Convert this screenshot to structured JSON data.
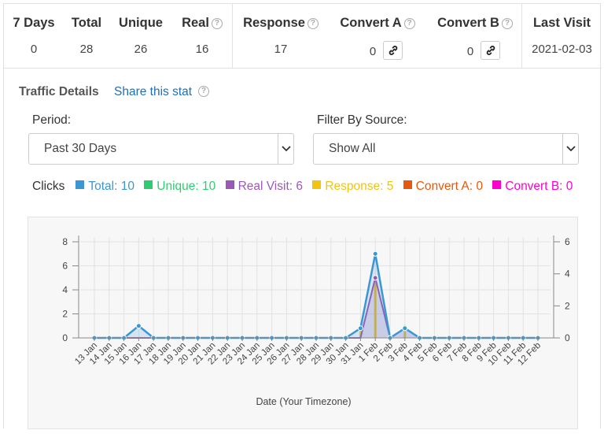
{
  "stats": {
    "columns": [
      {
        "label": "7 Days",
        "value": "0"
      },
      {
        "label": "Total",
        "value": "28"
      },
      {
        "label": "Unique",
        "value": "26"
      },
      {
        "label": "Real",
        "value": "16"
      },
      {
        "label": "Response",
        "value": "17"
      },
      {
        "label": "Convert A",
        "value": "0"
      },
      {
        "label": "Convert B",
        "value": "0"
      },
      {
        "label": "Last Visit",
        "value": "2021-02-03"
      }
    ],
    "help_glyph": "?"
  },
  "traffic": {
    "title": "Traffic Details",
    "share_label": "Share this stat",
    "period_label": "Period:",
    "period_value": "Past 30 Days",
    "source_label": "Filter By Source:",
    "source_value": "Show All"
  },
  "legend": {
    "title": "Clicks",
    "items": [
      {
        "label": "Total: 10",
        "color": "#3b97d3"
      },
      {
        "label": "Unique: 10",
        "color": "#2ecc71"
      },
      {
        "label": "Real Visit: 6",
        "color": "#9b59b6"
      },
      {
        "label": "Response: 5",
        "color": "#f1c40f"
      },
      {
        "label": "Convert A: 0",
        "color": "#e8580c"
      },
      {
        "label": "Convert B: 0",
        "color": "#ff00cc"
      }
    ]
  },
  "chart_data": {
    "type": "line",
    "xlabel": "Date (Your Timezone)",
    "categories": [
      "13 Jan",
      "14 Jan",
      "15 Jan",
      "16 Jan",
      "17 Jan",
      "18 Jan",
      "19 Jan",
      "20 Jan",
      "21 Jan",
      "22 Jan",
      "23 Jan",
      "24 Jan",
      "25 Jan",
      "26 Jan",
      "27 Jan",
      "28 Jan",
      "29 Jan",
      "30 Jan",
      "31 Jan",
      "1 Feb",
      "2 Feb",
      "3 Feb",
      "4 Feb",
      "5 Feb",
      "6 Feb",
      "7 Feb",
      "8 Feb",
      "9 Feb",
      "10 Feb",
      "11 Feb",
      "12 Feb"
    ],
    "left_ylim": [
      0,
      8
    ],
    "left_ticks": [
      "0",
      "2",
      "4",
      "6",
      "8"
    ],
    "right_ylim": [
      0,
      6
    ],
    "right_ticks": [
      "0",
      "2",
      "4",
      "6"
    ],
    "grid": true,
    "series": [
      {
        "name": "Total",
        "color": "#3b97d3",
        "axis": "left",
        "values": [
          0,
          0,
          0,
          1,
          0,
          0,
          0,
          0,
          0,
          0,
          0,
          0,
          0,
          0,
          0,
          0,
          0,
          0,
          0.8,
          7,
          0,
          0.8,
          0,
          0,
          0,
          0,
          0,
          0,
          0,
          0,
          0
        ]
      },
      {
        "name": "Unique",
        "color": "#2ecc71",
        "axis": "left",
        "values": [
          0,
          0,
          0,
          1,
          0,
          0,
          0,
          0,
          0,
          0,
          0,
          0,
          0,
          0,
          0,
          0,
          0,
          0,
          0.8,
          7,
          0,
          0.8,
          0,
          0,
          0,
          0,
          0,
          0,
          0,
          0,
          0
        ]
      },
      {
        "name": "Real Visit",
        "color": "#9b59b6",
        "axis": "left",
        "values": [
          0,
          0,
          0,
          0,
          0,
          0,
          0,
          0,
          0,
          0,
          0,
          0,
          0,
          0,
          0,
          0,
          0,
          0,
          0,
          5,
          0,
          0.8,
          0,
          0,
          0,
          0,
          0,
          0,
          0,
          0,
          0
        ]
      },
      {
        "name": "Response",
        "color": "#f1c40f",
        "axis": "right",
        "values": [
          0,
          0,
          0,
          0,
          0,
          0,
          0,
          0,
          0,
          0,
          0,
          0,
          0,
          0,
          0,
          0,
          0,
          0,
          0.6,
          3.5,
          0,
          0.8,
          0,
          0,
          0,
          0,
          0,
          0,
          0,
          0,
          0
        ]
      },
      {
        "name": "Convert A",
        "color": "#e8580c",
        "axis": "right",
        "values": [
          0,
          0,
          0,
          0,
          0,
          0,
          0,
          0,
          0,
          0,
          0,
          0,
          0,
          0,
          0,
          0,
          0,
          0,
          0,
          0,
          0,
          0,
          0,
          0,
          0,
          0,
          0,
          0,
          0,
          0,
          0
        ]
      },
      {
        "name": "Convert B",
        "color": "#ff00cc",
        "axis": "right",
        "values": [
          0,
          0,
          0,
          0,
          0,
          0,
          0,
          0,
          0,
          0,
          0,
          0,
          0,
          0,
          0,
          0,
          0,
          0,
          0,
          0,
          0,
          0,
          0,
          0,
          0,
          0,
          0,
          0,
          0,
          0,
          0
        ]
      }
    ]
  }
}
